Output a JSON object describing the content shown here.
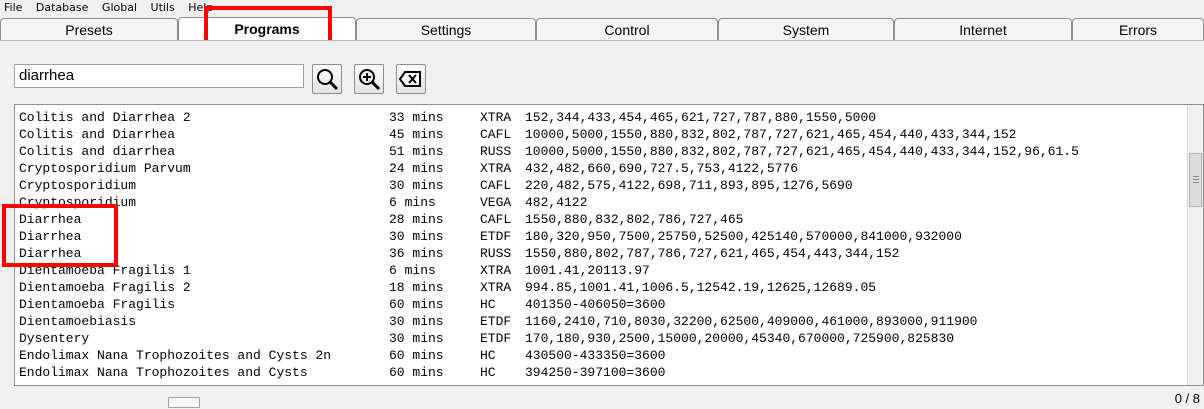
{
  "menu": [
    "File",
    "Database",
    "Global",
    "Utils",
    "Help"
  ],
  "tabs": [
    "Presets",
    "Programs",
    "Settings",
    "Control",
    "System",
    "Internet",
    "Errors"
  ],
  "search": {
    "value": "diarrhea"
  },
  "buttons": {
    "search_icon": "search-icon",
    "zoom_icon": "zoom-in-icon",
    "clear_icon": "backspace-icon"
  },
  "results": [
    {
      "name": "Colitis and Diarrhea 2",
      "mins": "33 mins",
      "type": "XTRA",
      "freq": "152,344,433,454,465,621,727,787,880,1550,5000"
    },
    {
      "name": "Colitis and Diarrhea",
      "mins": "45 mins",
      "type": "CAFL",
      "freq": "10000,5000,1550,880,832,802,787,727,621,465,454,440,433,344,152"
    },
    {
      "name": "Colitis and diarrhea",
      "mins": "51 mins",
      "type": "RUSS",
      "freq": "10000,5000,1550,880,832,802,787,727,621,465,454,440,433,344,152,96,61.5"
    },
    {
      "name": "Cryptosporidium Parvum",
      "mins": "24 mins",
      "type": "XTRA",
      "freq": "432,482,660,690,727.5,753,4122,5776"
    },
    {
      "name": "Cryptosporidium",
      "mins": "30 mins",
      "type": "CAFL",
      "freq": "220,482,575,4122,698,711,893,895,1276,5690"
    },
    {
      "name": "Cryptosporidium",
      "mins": "6 mins",
      "type": "VEGA",
      "freq": "482,4122"
    },
    {
      "name": "Diarrhea",
      "mins": "28 mins",
      "type": "CAFL",
      "freq": "1550,880,832,802,786,727,465"
    },
    {
      "name": "Diarrhea",
      "mins": "30 mins",
      "type": "ETDF",
      "freq": "180,320,950,7500,25750,52500,425140,570000,841000,932000"
    },
    {
      "name": "Diarrhea",
      "mins": "36 mins",
      "type": "RUSS",
      "freq": "1550,880,802,787,786,727,621,465,454,443,344,152"
    },
    {
      "name": "Dientamoeba Fragilis 1",
      "mins": "6 mins",
      "type": "XTRA",
      "freq": "1001.41,20113.97"
    },
    {
      "name": "Dientamoeba Fragilis 2",
      "mins": "18 mins",
      "type": "XTRA",
      "freq": "994.85,1001.41,1006.5,12542.19,12625,12689.05"
    },
    {
      "name": "Dientamoeba Fragilis",
      "mins": "60 mins",
      "type": "HC",
      "freq": "401350-406050=3600"
    },
    {
      "name": "Dientamoebiasis",
      "mins": "30 mins",
      "type": "ETDF",
      "freq": "1160,2410,710,8030,32200,62500,409000,461000,893000,911900"
    },
    {
      "name": "Dysentery",
      "mins": "30 mins",
      "type": "ETDF",
      "freq": "170,180,930,2500,15000,20000,45340,670000,725900,825830"
    },
    {
      "name": "Endolimax Nana Trophozoites and Cysts 2n",
      "mins": "60 mins",
      "type": "HC",
      "freq": "430500-433350=3600"
    },
    {
      "name": "Endolimax Nana Trophozoites and Cysts",
      "mins": "60 mins",
      "type": "HC",
      "freq": "394250-397100=3600"
    }
  ],
  "footer": {
    "count": "0 / 8"
  }
}
